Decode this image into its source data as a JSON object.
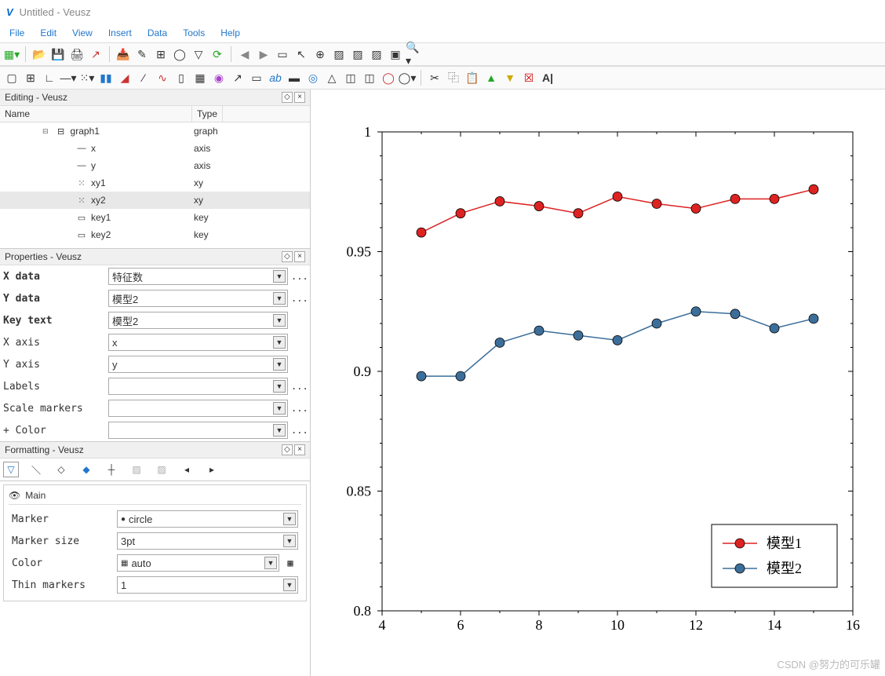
{
  "window": {
    "title": "Untitled - Veusz"
  },
  "menu": [
    "File",
    "Edit",
    "View",
    "Insert",
    "Data",
    "Tools",
    "Help"
  ],
  "docks": {
    "editing": {
      "title": "Editing - Veusz",
      "columns": [
        "Name",
        "Type"
      ],
      "rows": [
        {
          "name": "graph1",
          "type": "graph",
          "indent": 1,
          "icon": "⊟"
        },
        {
          "name": "x",
          "type": "axis",
          "indent": 2,
          "icon": "—"
        },
        {
          "name": "y",
          "type": "axis",
          "indent": 2,
          "icon": "—"
        },
        {
          "name": "xy1",
          "type": "xy",
          "indent": 2,
          "icon": "⁙"
        },
        {
          "name": "xy2",
          "type": "xy",
          "indent": 2,
          "icon": "⁙",
          "selected": true
        },
        {
          "name": "key1",
          "type": "key",
          "indent": 2,
          "icon": "▭"
        },
        {
          "name": "key2",
          "type": "key",
          "indent": 2,
          "icon": "▭"
        }
      ]
    },
    "properties": {
      "title": "Properties - Veusz",
      "rows": [
        {
          "label": "X data",
          "value": "特征数",
          "bold": true,
          "extra": "..."
        },
        {
          "label": "Y data",
          "value": "模型2",
          "bold": true,
          "extra": "..."
        },
        {
          "label": "Key text",
          "value": "模型2",
          "bold": true,
          "extra": ""
        },
        {
          "label": "X axis",
          "value": "x",
          "bold": false,
          "extra": ""
        },
        {
          "label": "Y axis",
          "value": "y",
          "bold": false,
          "extra": ""
        },
        {
          "label": "Labels",
          "value": "",
          "bold": false,
          "extra": "..."
        },
        {
          "label": "Scale markers",
          "value": "",
          "bold": false,
          "extra": "..."
        },
        {
          "label": "+ Color",
          "value": "",
          "bold": false,
          "extra": "..."
        }
      ]
    },
    "formatting": {
      "title": "Formatting - Veusz",
      "main_label": "Main",
      "rows": [
        {
          "label": "Marker",
          "value": "circle",
          "icon": "●"
        },
        {
          "label": "Marker size",
          "value": "3pt"
        },
        {
          "label": "Color",
          "value": "auto",
          "icon": "▦"
        },
        {
          "label": "Thin markers",
          "value": "1"
        }
      ]
    }
  },
  "chart_data": {
    "type": "line",
    "x": [
      5,
      6,
      7,
      8,
      9,
      10,
      11,
      12,
      13,
      14,
      15
    ],
    "series": [
      {
        "name": "模型1",
        "color": "#d22",
        "values": [
          0.958,
          0.966,
          0.971,
          0.969,
          0.966,
          0.973,
          0.97,
          0.968,
          0.972,
          0.972,
          0.976
        ]
      },
      {
        "name": "模型2",
        "color": "#3c6e9a",
        "values": [
          0.898,
          0.898,
          0.912,
          0.917,
          0.915,
          0.913,
          0.92,
          0.925,
          0.924,
          0.918,
          0.922
        ]
      }
    ],
    "xlim": [
      4,
      16
    ],
    "ylim": [
      0.8,
      1.0
    ],
    "xticks": [
      4,
      6,
      8,
      10,
      12,
      14,
      16
    ],
    "yticks": [
      0.8,
      0.85,
      0.9,
      0.95,
      1.0
    ],
    "legend": [
      "模型1",
      "模型2"
    ]
  },
  "watermark": "CSDN @努力的可乐罐"
}
